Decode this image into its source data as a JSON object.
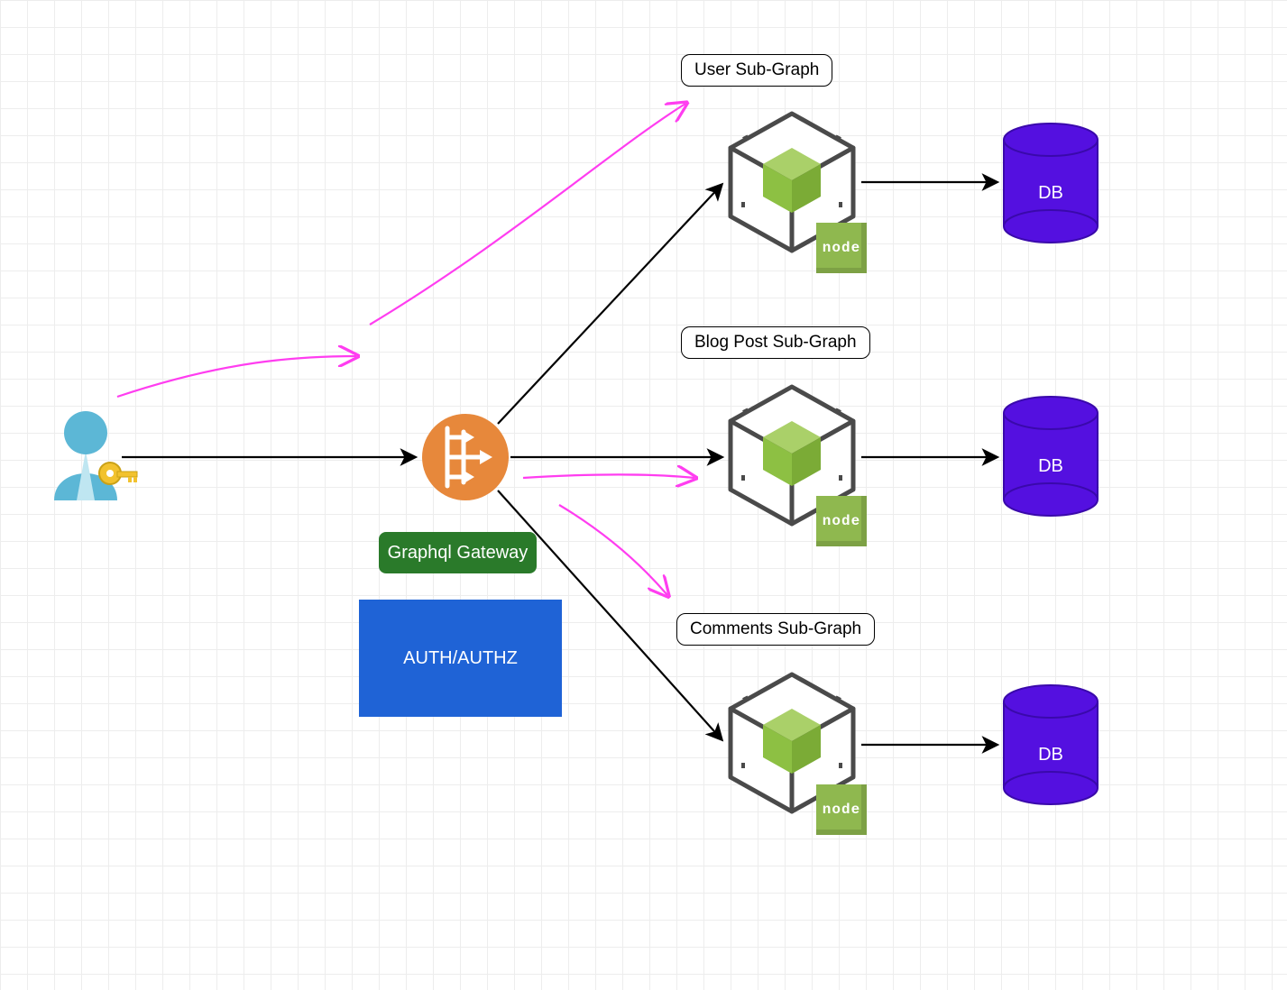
{
  "nodes": {
    "user_subgraph": {
      "label": "User Sub-Graph"
    },
    "blogpost_subgraph": {
      "label": "Blog Post Sub-Graph"
    },
    "comments_subgraph": {
      "label": "Comments Sub-Graph"
    },
    "gateway": {
      "label": "Graphql Gateway"
    },
    "auth": {
      "label": "AUTH/AUTHZ"
    },
    "node_badge": {
      "label": "node"
    },
    "db": {
      "label": "DB"
    }
  },
  "colors": {
    "grid": "#dcdcdc",
    "gateway": "#e7883b",
    "green": "#2a7a2a",
    "blue": "#1f63d6",
    "purple": "#5410e0",
    "magenta": "#ff3df0",
    "node": "#8FB84F",
    "cube": "#8dc043",
    "user": "#5cb7d6"
  }
}
